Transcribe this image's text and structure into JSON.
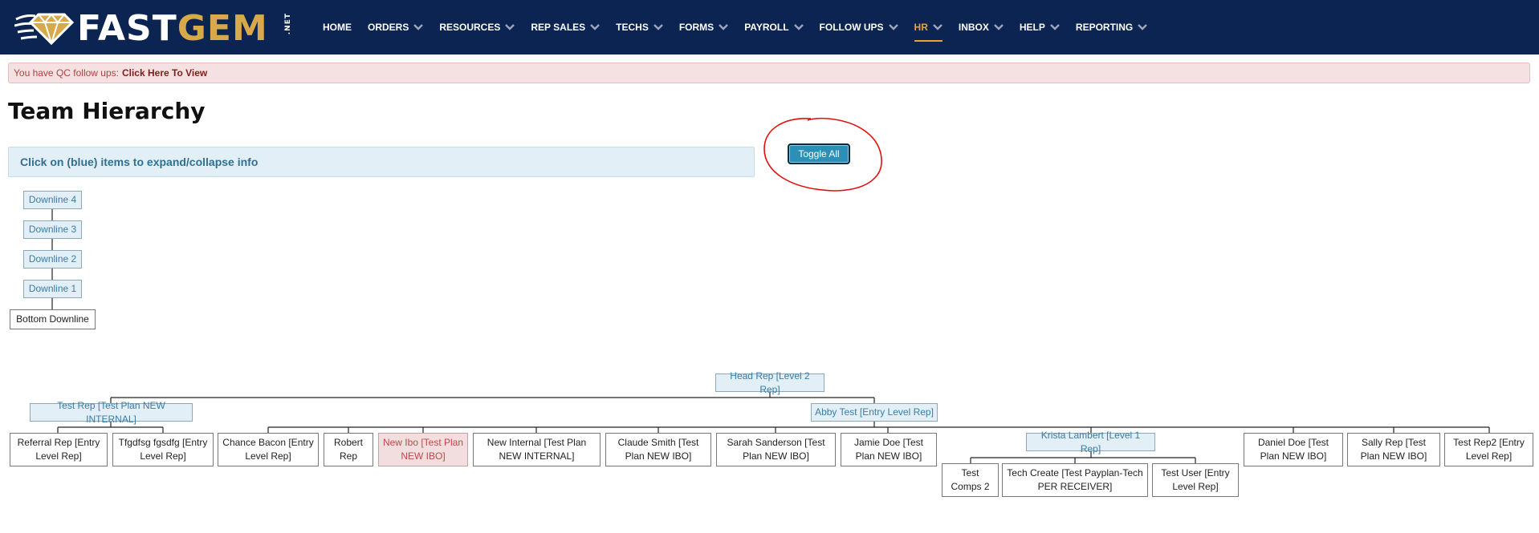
{
  "brand": {
    "logo_fast": "FAST",
    "logo_gem": "GEM",
    "logo_net": ".NET",
    "accent_color": "#e8a33d",
    "nav_bg": "#0c2451"
  },
  "nav": {
    "home": "HOME",
    "orders": "ORDERS",
    "resources": "RESOURCES",
    "rep_sales": "REP SALES",
    "techs": "TECHS",
    "forms": "FORMS",
    "payroll": "PAYROLL",
    "follow_ups": "FOLLOW UPS",
    "hr": "HR",
    "inbox": "INBOX",
    "help": "HELP",
    "reporting": "REPORTING"
  },
  "alert": {
    "text": "You have QC follow ups:",
    "link": "Click Here To View"
  },
  "page": {
    "title": "Team Hierarchy",
    "info": "Click on (blue) items to expand/collapse info",
    "toggle_all": "Toggle All"
  },
  "downline": {
    "d4": "Downline 4",
    "d3": "Downline 3",
    "d2": "Downline 2",
    "d1": "Downline 1",
    "bottom": "Bottom Downline"
  },
  "tree": {
    "head": "Head Rep [Level 2 Rep]",
    "test_rep": "Test Rep [Test Plan NEW INTERNAL]",
    "abby": "Abby Test [Entry Level Rep]",
    "referral": "Referral Rep [Entry Level Rep]",
    "tfgdfsg": "Tfgdfsg fgsdfg [Entry Level Rep]",
    "chance": "Chance Bacon [Entry Level Rep]",
    "robert": "Robert Rep",
    "new_ibo": "New Ibo [Test Plan NEW IBO]",
    "new_internal": "New Internal [Test Plan NEW INTERNAL]",
    "claude": "Claude Smith [Test Plan NEW IBO]",
    "sarah": "Sarah Sanderson [Test Plan NEW IBO]",
    "jamie": "Jamie Doe [Test Plan NEW IBO]",
    "krista": "Krista Lambert [Level 1 Rep]",
    "daniel": "Daniel Doe [Test Plan NEW IBO]",
    "sally": "Sally Rep [Test Plan NEW IBO]",
    "test_rep2": "Test Rep2 [Entry Level Rep]",
    "test_comps": "Test Comps 2",
    "tech_create": "Tech Create [Test Payplan-Tech PER RECEIVER]",
    "test_user": "Test User [Entry Level Rep]"
  }
}
